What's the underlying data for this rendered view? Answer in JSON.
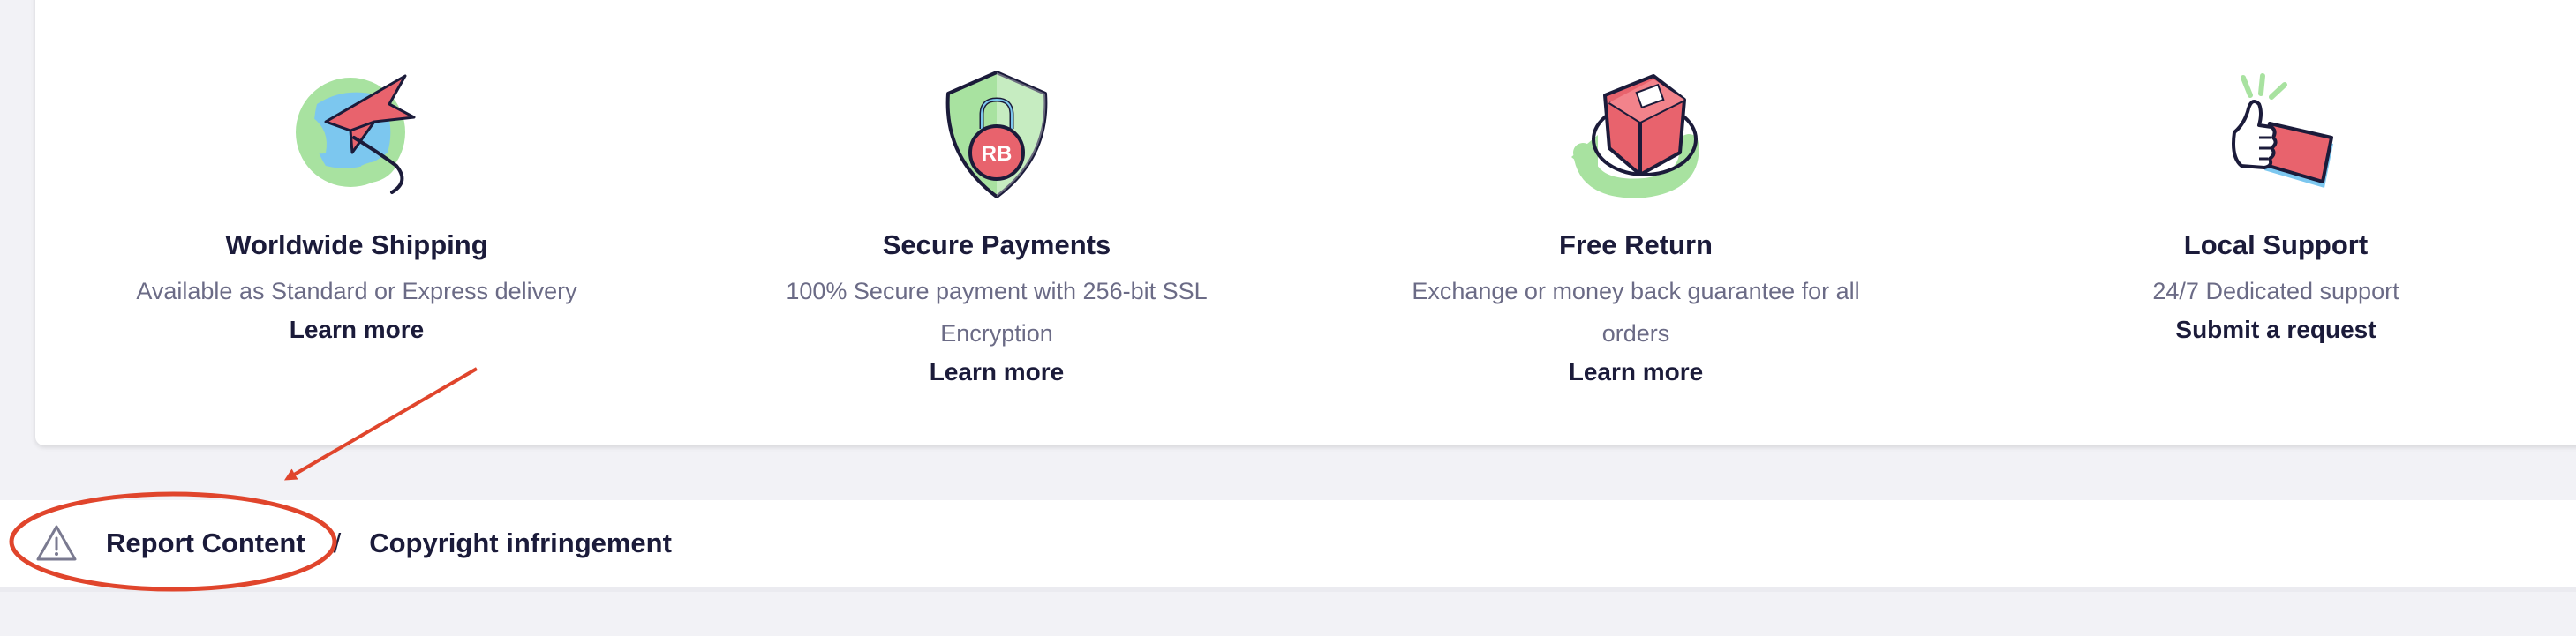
{
  "features": [
    {
      "title": "Worldwide Shipping",
      "desc_lines": [
        "Available as Standard or Express delivery"
      ],
      "link": "Learn more",
      "icon": "globe-plane-icon"
    },
    {
      "title": "Secure Payments",
      "desc_lines": [
        "100% Secure payment with 256-bit SSL",
        "Encryption"
      ],
      "link": "Learn more",
      "icon": "shield-lock-icon",
      "icon_text": "RB"
    },
    {
      "title": "Free Return",
      "desc_lines": [
        "Exchange or money back guarantee for all",
        "orders"
      ],
      "link": "Learn more",
      "icon": "box-return-icon"
    },
    {
      "title": "Local Support",
      "desc_lines": [
        "24/7 Dedicated support"
      ],
      "link": "Submit a request",
      "icon": "thumbs-up-icon"
    }
  ],
  "footer": {
    "report_label": "Report Content",
    "separator": "/",
    "copyright_label": "Copyright infringement"
  },
  "colors": {
    "navy": "#1b1b3a",
    "muted": "#6b6b86",
    "coral": "#e8636d",
    "green": "#a8e2a0",
    "blue": "#7cc7ef",
    "annotation_red": "#e0452c"
  }
}
